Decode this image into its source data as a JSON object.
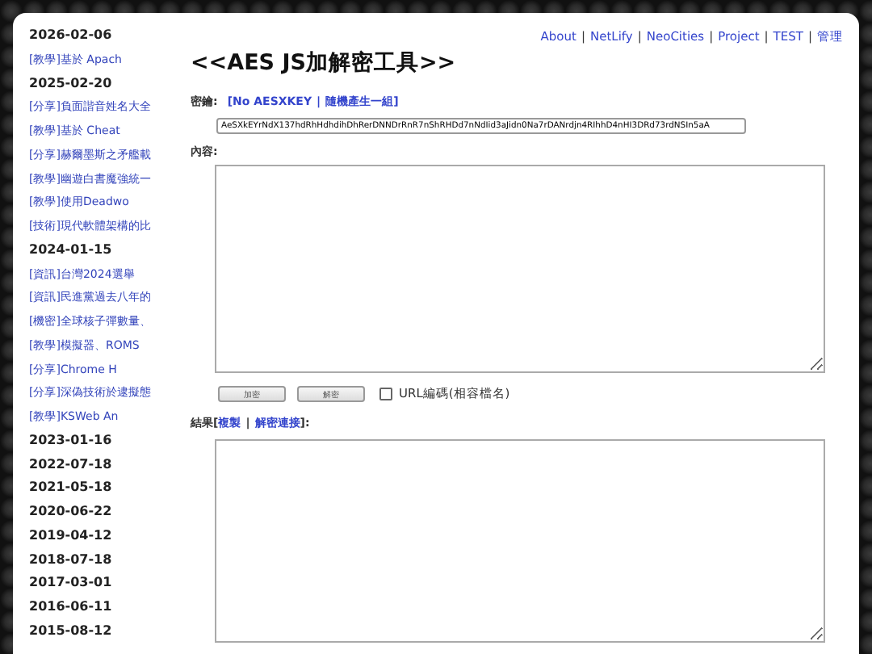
{
  "nav_links": [
    "About",
    "NetLify",
    "NeoCities",
    "Project",
    "TEST",
    "管理"
  ],
  "nav_separator": "|",
  "sidebar": [
    {
      "kind": "date",
      "text": "2026-02-06"
    },
    {
      "kind": "post",
      "text": "[教學]基於 Apach"
    },
    {
      "kind": "date",
      "text": "2025-02-20"
    },
    {
      "kind": "post",
      "text": "[分享]負面諧音姓名大全"
    },
    {
      "kind": "post",
      "text": "[教學]基於 Cheat"
    },
    {
      "kind": "post",
      "text": "[分享]赫爾墨斯之矛艦載"
    },
    {
      "kind": "post",
      "text": "[教學]幽遊白書魔強統一"
    },
    {
      "kind": "post",
      "text": "[教學]使用Deadwo"
    },
    {
      "kind": "post",
      "text": "[技術]現代軟體架構的比"
    },
    {
      "kind": "date",
      "text": "2024-01-15"
    },
    {
      "kind": "post",
      "text": "[資訊]台灣2024選舉"
    },
    {
      "kind": "post",
      "text": "[資訊]民進黨過去八年的"
    },
    {
      "kind": "post",
      "text": "[機密]全球核子彈數量、"
    },
    {
      "kind": "post",
      "text": "[教學]模擬器、ROMS"
    },
    {
      "kind": "post",
      "text": "[分享]Chrome H"
    },
    {
      "kind": "post",
      "text": "[分享]深偽技術於逮擬態"
    },
    {
      "kind": "post",
      "text": "[教學]KSWeb An"
    },
    {
      "kind": "date",
      "text": "2023-01-16"
    },
    {
      "kind": "date",
      "text": "2022-07-18"
    },
    {
      "kind": "date",
      "text": "2021-05-18"
    },
    {
      "kind": "date",
      "text": "2020-06-22"
    },
    {
      "kind": "date",
      "text": "2019-04-12"
    },
    {
      "kind": "date",
      "text": "2018-07-18"
    },
    {
      "kind": "date",
      "text": "2017-03-01"
    },
    {
      "kind": "date",
      "text": "2016-06-11"
    },
    {
      "kind": "date",
      "text": "2015-08-12"
    }
  ],
  "title": "<<AES JS加解密工具>>",
  "key": {
    "label": "密鑰:",
    "open": "[",
    "separator": "|",
    "close": "]",
    "links": [
      "No AESXKEY",
      "隨機產生一組"
    ],
    "value": "AeSXkEYrNdX137hdRhHdhdihDhRerDNNDrRnR7nShRHDd7nNdIid3aJidn0Na7rDANrdjn4RIhhD4nHI3DRd73rdNSIn5aA"
  },
  "content_label": "內容:",
  "buttons": [
    "加密",
    "解密"
  ],
  "url_encode": {
    "label": "URL編碼(相容檔名)",
    "checked": false
  },
  "result": {
    "label": "結果",
    "open": "[",
    "separator": "|",
    "close": "]:",
    "links": [
      "複製",
      "解密連接"
    ]
  }
}
